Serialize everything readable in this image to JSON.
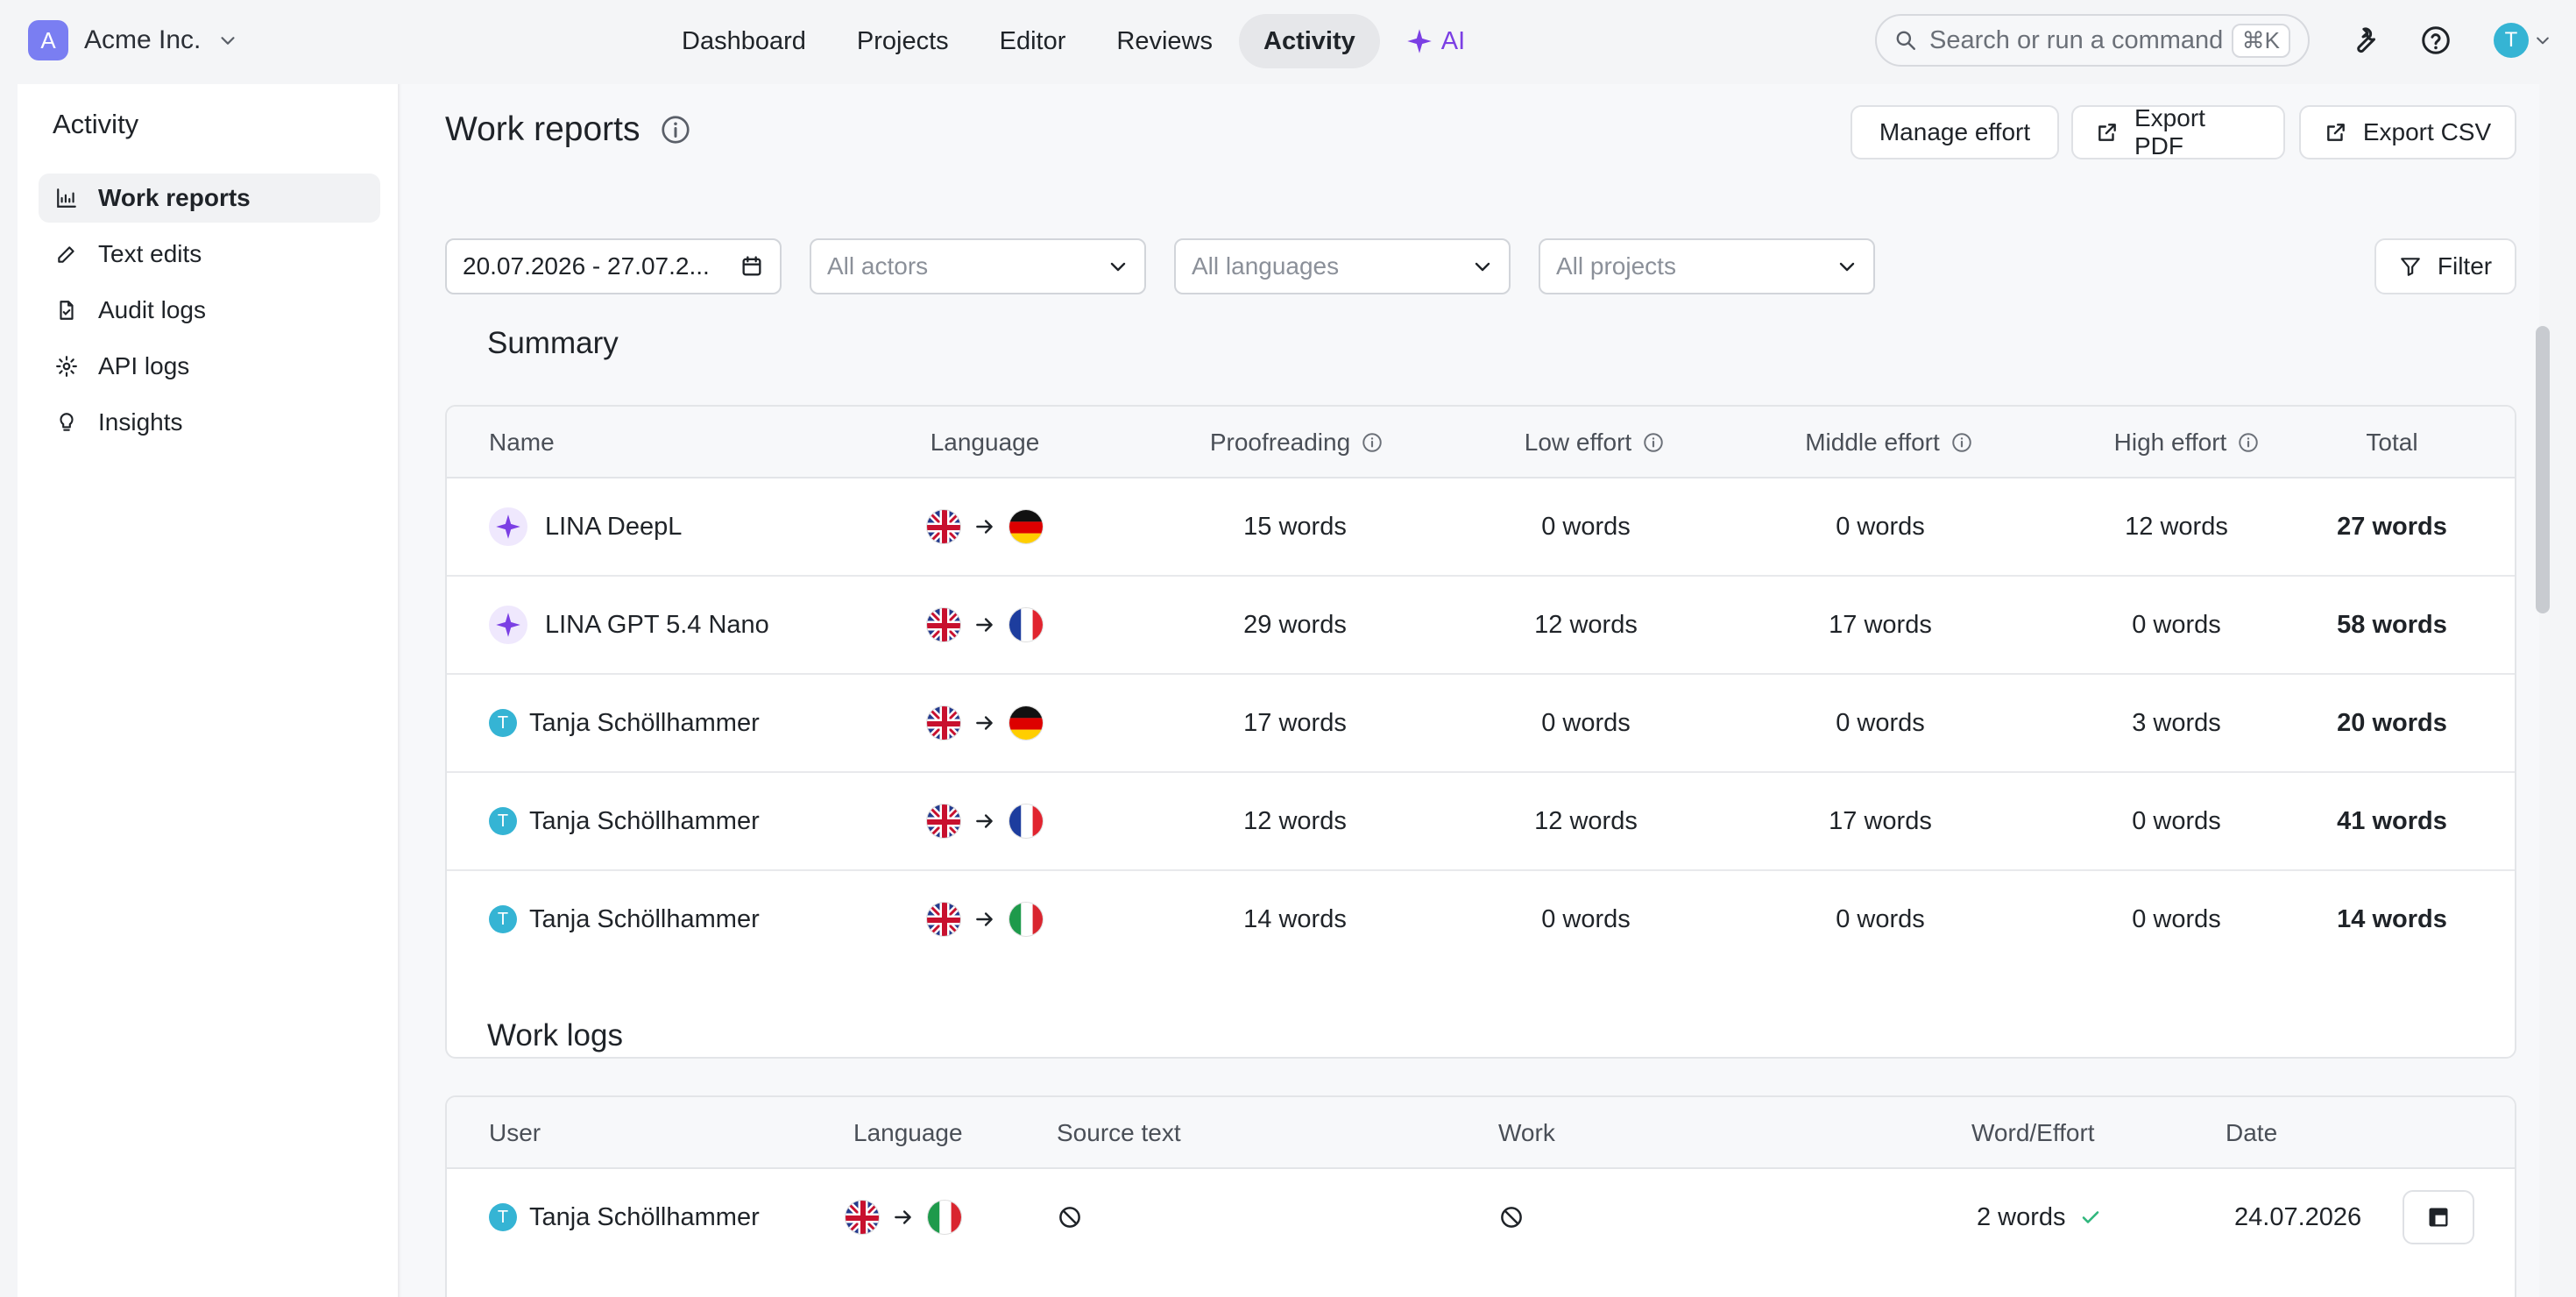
{
  "org": {
    "initial": "A",
    "name": "Acme Inc."
  },
  "nav": {
    "items": [
      {
        "label": "Dashboard",
        "active": false
      },
      {
        "label": "Projects",
        "active": false
      },
      {
        "label": "Editor",
        "active": false
      },
      {
        "label": "Reviews",
        "active": false
      },
      {
        "label": "Activity",
        "active": true
      },
      {
        "label": "AI",
        "active": false
      }
    ]
  },
  "search": {
    "placeholder": "Search or run a command",
    "shortcut": "⌘K"
  },
  "user": {
    "initial": "T"
  },
  "sidebar": {
    "title": "Activity",
    "items": [
      {
        "label": "Work reports",
        "icon": "chart-icon",
        "active": true
      },
      {
        "label": "Text edits",
        "icon": "pencil-icon",
        "active": false
      },
      {
        "label": "Audit logs",
        "icon": "file-check-icon",
        "active": false
      },
      {
        "label": "API logs",
        "icon": "api-gear-icon",
        "active": false
      },
      {
        "label": "Insights",
        "icon": "lightbulb-icon",
        "active": false
      }
    ]
  },
  "page": {
    "title": "Work reports",
    "buttons": {
      "manage_effort": "Manage effort",
      "export_pdf": "Export PDF",
      "export_csv": "Export CSV",
      "filter": "Filter"
    },
    "filters": {
      "date_range": "20.07.2026 - 27.07.2...",
      "actors_placeholder": "All actors",
      "languages_placeholder": "All languages",
      "projects_placeholder": "All projects"
    }
  },
  "summary": {
    "title": "Summary",
    "columns": [
      "Name",
      "Language",
      "Proofreading",
      "Low effort",
      "Middle effort",
      "High effort",
      "Total"
    ],
    "rows": [
      {
        "name": "LINA DeepL",
        "type": "ai",
        "from": "en",
        "to": "de",
        "proofreading": "15 words",
        "low": "0 words",
        "middle": "0 words",
        "high": "12 words",
        "total": "27 words"
      },
      {
        "name": "LINA GPT 5.4 Nano",
        "type": "ai",
        "from": "en",
        "to": "fr",
        "proofreading": "29 words",
        "low": "12 words",
        "middle": "17 words",
        "high": "0 words",
        "total": "58 words"
      },
      {
        "name": "Tanja Schöllhammer",
        "type": "user",
        "initial": "T",
        "from": "en",
        "to": "de",
        "proofreading": "17 words",
        "low": "0 words",
        "middle": "0 words",
        "high": "3 words",
        "total": "20 words"
      },
      {
        "name": "Tanja Schöllhammer",
        "type": "user",
        "initial": "T",
        "from": "en",
        "to": "fr",
        "proofreading": "12 words",
        "low": "12 words",
        "middle": "17 words",
        "high": "0 words",
        "total": "41 words"
      },
      {
        "name": "Tanja Schöllhammer",
        "type": "user",
        "initial": "T",
        "from": "en",
        "to": "it",
        "proofreading": "14 words",
        "low": "0 words",
        "middle": "0 words",
        "high": "0 words",
        "total": "14 words"
      }
    ]
  },
  "worklogs": {
    "title": "Work logs",
    "columns": [
      "User",
      "Language",
      "Source text",
      "Work",
      "Word/Effort",
      "Date"
    ],
    "rows": [
      {
        "user": "Tanja Schöllhammer",
        "initial": "T",
        "from": "en",
        "to": "it",
        "word_effort": "2 words",
        "date": "24.07.2026"
      }
    ]
  },
  "colors": {
    "accent": "#7b3fe4",
    "user_avatar": "#35b4d4",
    "org_avatar": "#7a7ef2",
    "check": "#2fb67c"
  }
}
